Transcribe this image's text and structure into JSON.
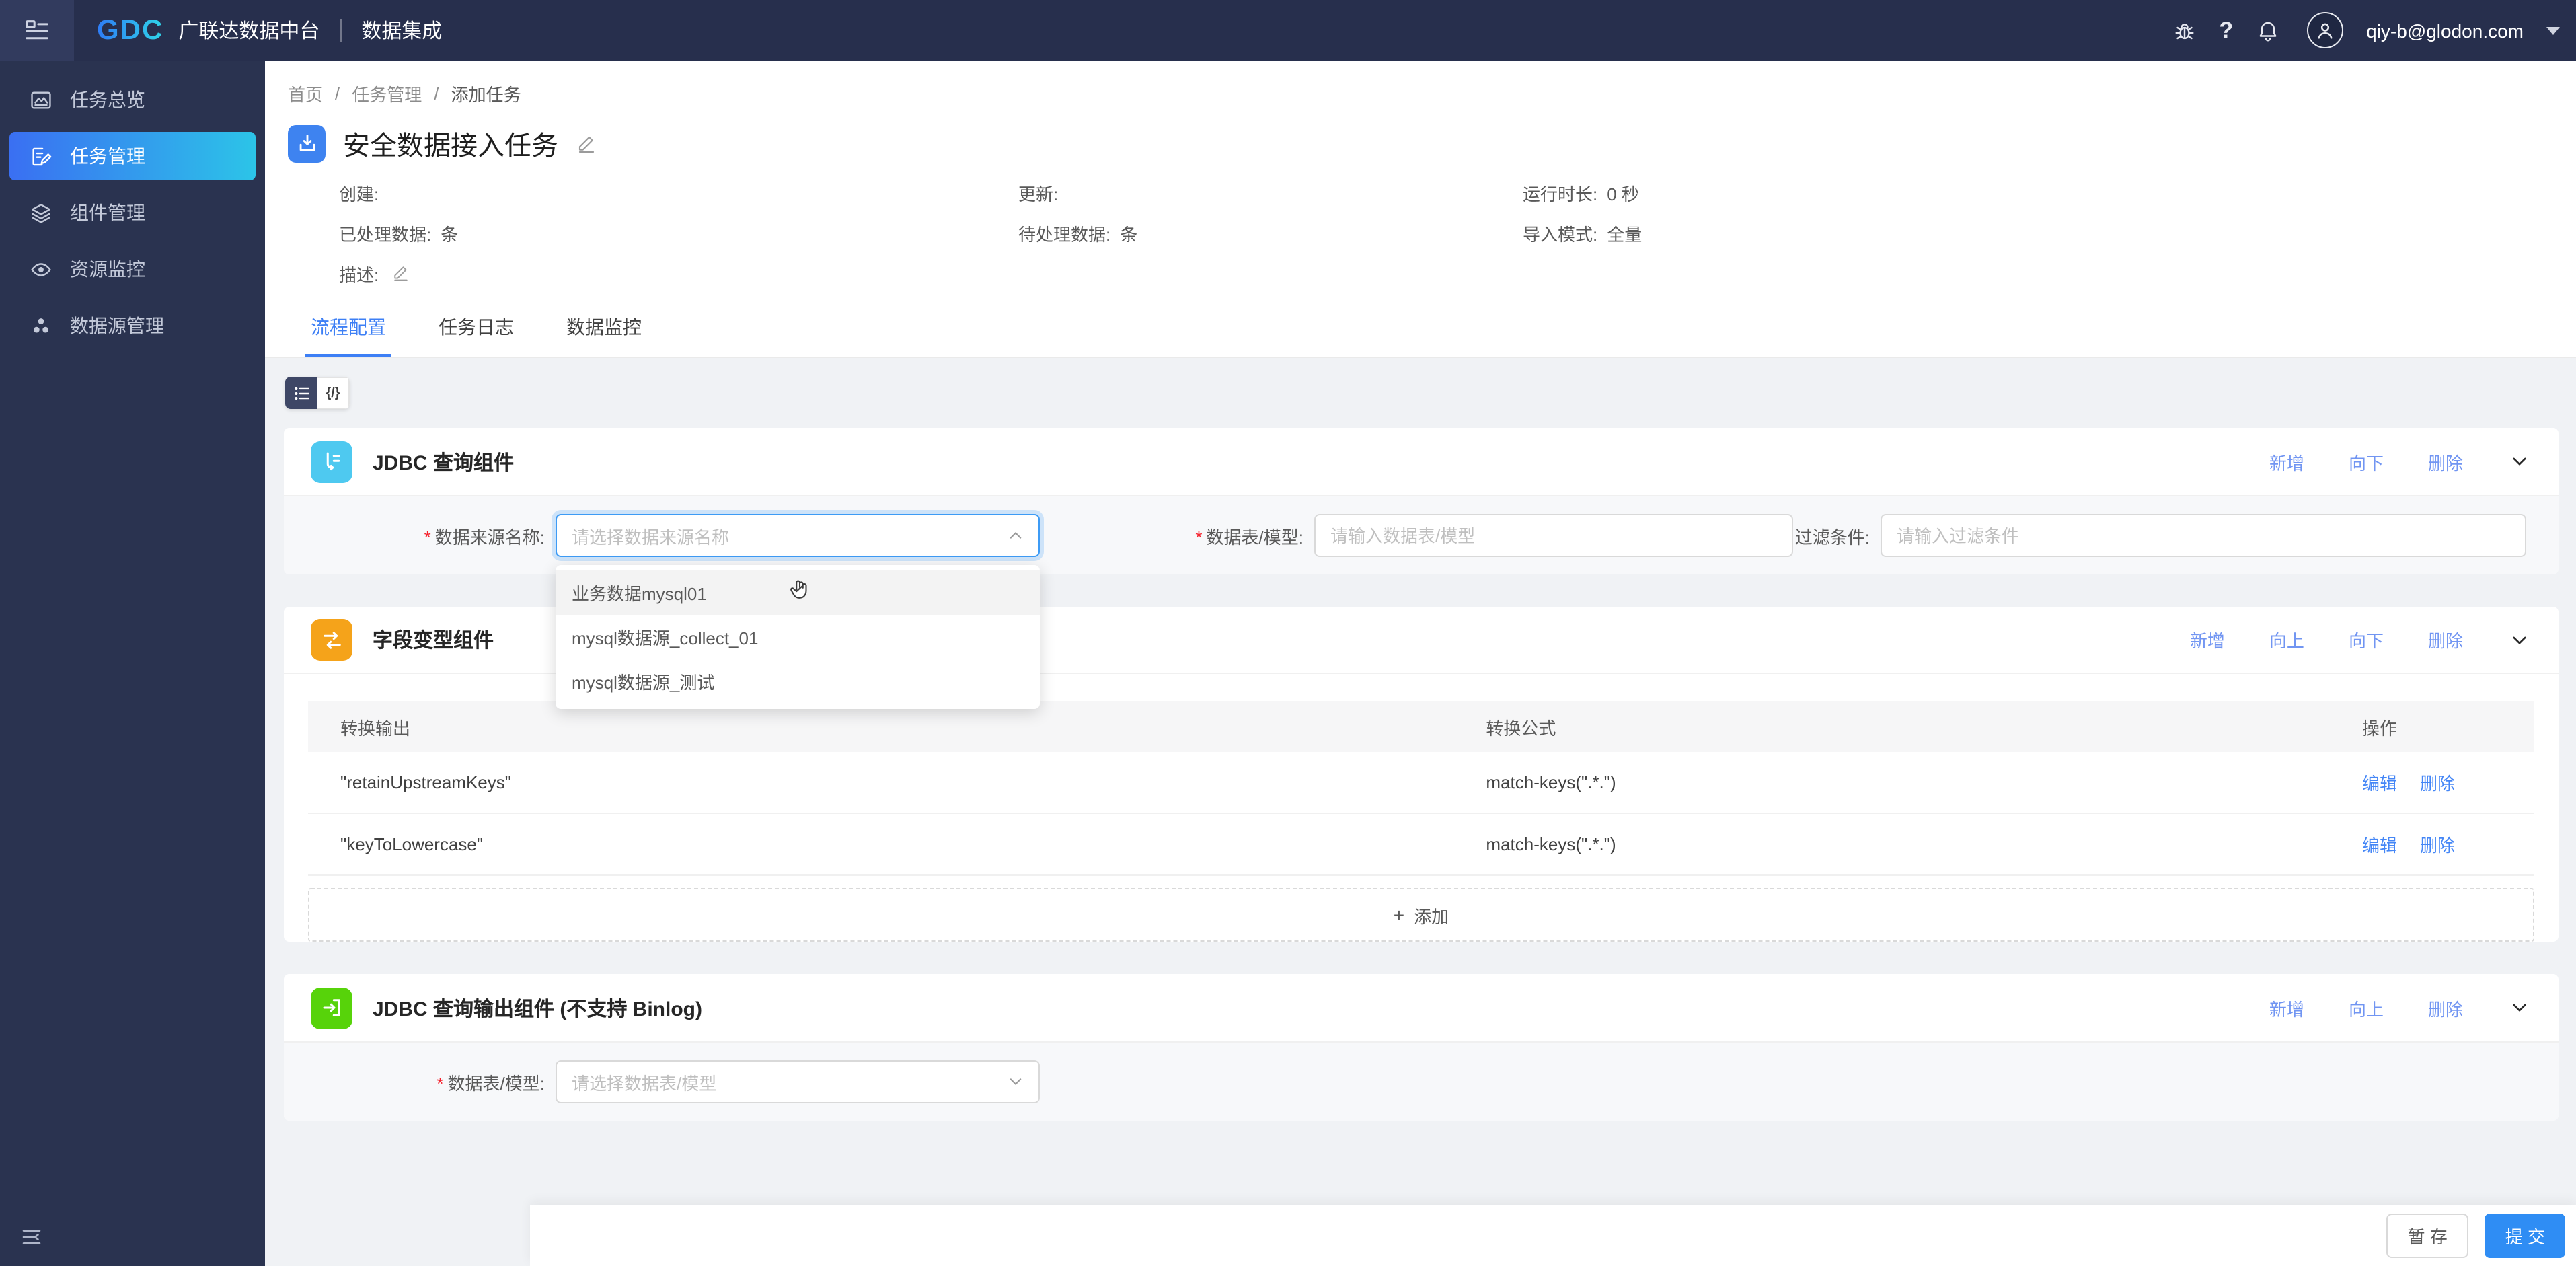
{
  "colors": {
    "header_navy": "#272f4d",
    "sidebar_navy": "#2a3350",
    "sidebar_active_from": "#3a6ff2",
    "sidebar_active_to": "#2cc4e8",
    "accent_blue": "#3d7ff5",
    "section_link_blue": "#7195f2",
    "table_link_blue": "#4486f6",
    "submit_blue": "#2f8df4",
    "icon_cyan": "#4ec9f0",
    "icon_orange": "#f5a31a",
    "icon_green": "#57d30a",
    "required_red": "#f5222d"
  },
  "header": {
    "logo_text": "GDC",
    "product_name": "广联达数据中台",
    "module_name": "数据集成",
    "help_glyph": "?",
    "user_email": "qiy-b@glodon.com"
  },
  "sidebar": {
    "items": [
      {
        "label": "任务总览"
      },
      {
        "label": "任务管理"
      },
      {
        "label": "组件管理"
      },
      {
        "label": "资源监控"
      },
      {
        "label": "数据源管理"
      }
    ]
  },
  "breadcrumb": {
    "items": [
      "首页",
      "任务管理",
      "添加任务"
    ],
    "separator": "/"
  },
  "required_mark": "*",
  "task": {
    "title": "安全数据接入任务",
    "meta": {
      "created_label": "创建:",
      "updated_label": "更新:",
      "runtime_label": "运行时长:",
      "runtime_value": "0 秒",
      "processed_label": "已处理数据:",
      "processed_value": "条",
      "pending_label": "待处理数据:",
      "pending_value": "条",
      "mode_label": "导入模式:",
      "mode_value": "全量",
      "desc_label": "描述:"
    }
  },
  "tabs": [
    {
      "label": "流程配置"
    },
    {
      "label": "任务日志"
    },
    {
      "label": "数据监控"
    }
  ],
  "toolbar": {
    "code_view_label": "{/}"
  },
  "sections": {
    "jdbc_query": {
      "title": "JDBC 查询组件",
      "actions": {
        "add": "新增",
        "down": "向下",
        "delete": "删除"
      },
      "datasource_label": "数据来源名称:",
      "datasource_placeholder": "请选择数据来源名称",
      "table_label": "数据表/模型:",
      "table_placeholder": "请输入数据表/模型",
      "filter_label": "过滤条件:",
      "filter_placeholder": "请输入过滤条件",
      "dropdown_options": [
        "业务数据mysql01",
        "mysql数据源_collect_01",
        "mysql数据源_测试"
      ]
    },
    "field_transform": {
      "title": "字段变型组件",
      "actions": {
        "add": "新增",
        "up": "向上",
        "down": "向下",
        "delete": "删除"
      },
      "table": {
        "col_output": "转换输出",
        "col_formula": "转换公式",
        "col_ops": "操作",
        "rows": [
          {
            "output": "\"retainUpstreamKeys\"",
            "formula": "match-keys(\".*.\")"
          },
          {
            "output": "\"keyToLowercase\"",
            "formula": "match-keys(\".*.\")"
          }
        ],
        "edit_label": "编辑",
        "delete_label": "删除",
        "add_plus": "+",
        "add_label": "添加"
      }
    },
    "jdbc_output": {
      "title": "JDBC 查询输出组件 (不支持 Binlog)",
      "actions": {
        "add": "新增",
        "up": "向上",
        "delete": "删除"
      },
      "table_label": "数据表/模型:",
      "table_placeholder": "请选择数据表/模型"
    }
  },
  "footer": {
    "draft_label": "暂 存",
    "submit_label": "提 交"
  }
}
